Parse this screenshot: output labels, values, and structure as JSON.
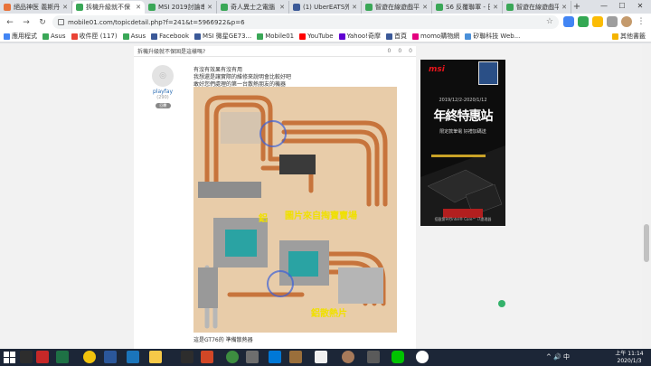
{
  "tabs": [
    {
      "label": "絕品神医 義斯丹",
      "favicon": "#e8733a",
      "active": false
    },
    {
      "label": "拆機升級就不保",
      "favicon": "#3aa757",
      "active": true
    },
    {
      "label": "MSI 2019討論串",
      "favicon": "#3aa757",
      "active": false
    },
    {
      "label": "奇人異士之電腦",
      "favicon": "#3aa757",
      "active": false
    },
    {
      "label": "(1) UberEATS外",
      "favicon": "#3b5998",
      "active": false
    },
    {
      "label": "智遊在線遊戲平",
      "favicon": "#3aa757",
      "active": false
    },
    {
      "label": "S6 反覆聯軍 - 巴",
      "favicon": "#3aa757",
      "active": false
    },
    {
      "label": "智遊在線遊戲平",
      "favicon": "#3aa757",
      "active": false
    }
  ],
  "window_controls": {
    "minimize": "—",
    "maximize": "☐",
    "close": "✕"
  },
  "toolbar": {
    "url": "mobile01.com/topicdetail.php?f=241&t=5966922&p=6",
    "back": "←",
    "forward": "→",
    "reload": "↻",
    "home": "⌂",
    "star": "☆"
  },
  "bookmarks": [
    {
      "label": "應用程式",
      "color": "#4285f4"
    },
    {
      "label": "Asus",
      "color": "#3aa757"
    },
    {
      "label": "收件匣 (117)",
      "color": "#ea4335"
    },
    {
      "label": "Asus",
      "color": "#3aa757"
    },
    {
      "label": "Facebook",
      "color": "#3b5998"
    },
    {
      "label": "MSI 微星GE73...",
      "color": "#3b5998"
    },
    {
      "label": "Mobile01",
      "color": "#3aa757"
    },
    {
      "label": "YouTube",
      "color": "#ff0000"
    },
    {
      "label": "Yahoo!奇摩",
      "color": "#6001d2"
    },
    {
      "label": "首頁",
      "color": "#3b5998"
    },
    {
      "label": "momo購物網",
      "color": "#e4007f"
    },
    {
      "label": "矽聯科技 Web...",
      "color": "#4a90d9"
    },
    {
      "label": "其他書籤",
      "color": "#f4b400"
    }
  ],
  "topic": {
    "title": "拆機升級就不保固是這樣嗎?",
    "stats": [
      "0",
      "0",
      "0"
    ]
  },
  "post": {
    "username": "playfay",
    "post_count": "(290)",
    "badge": "回覆",
    "lines": [
      "有沒有效果有沒有用",
      "我想還是讓實際的維修來說明會比較好吧",
      "敢好您們處理的第一台散熱朋友的機器"
    ],
    "watermark_1": "鋁",
    "watermark_2": "圖片來自掏寶賣場",
    "watermark_3": "鋁散熱片",
    "caption": "這是GT76的 準備散熱器"
  },
  "ad": {
    "brand": "msi",
    "date": "2019/12/2-2020/1/12",
    "title": "年終特惠站",
    "subtitle": "限定款筆電 好禮加碼送",
    "footer": "搭載第9代Intel® Core™ i7處理器"
  },
  "taskbar": {
    "time": "上午 11:14",
    "date": "2020/1/3",
    "tray": "^ 🔊 中"
  }
}
